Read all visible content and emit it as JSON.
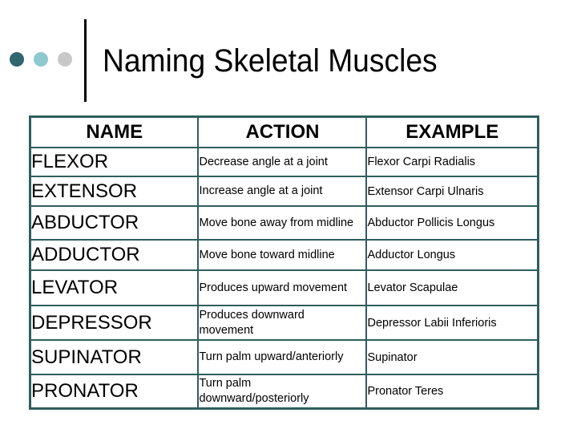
{
  "slide": {
    "title": "Naming Skeletal Muscles",
    "decor": {
      "dot_colors": [
        "#2f6670",
        "#8ec9cf",
        "#c8c8c8"
      ],
      "border_color": "#2f5e5e"
    }
  },
  "table": {
    "headers": [
      "NAME",
      "ACTION",
      "EXAMPLE"
    ],
    "rows": [
      {
        "name": "FLEXOR",
        "action": "Decrease angle at a joint",
        "example": "Flexor Carpi Radialis"
      },
      {
        "name": "EXTENSOR",
        "action": "Increase angle at a joint",
        "example": "Extensor Carpi Ulnaris"
      },
      {
        "name": "ABDUCTOR",
        "action": "Move bone away from midline",
        "example": "Abductor Pollicis Longus"
      },
      {
        "name": "ADDUCTOR",
        "action": "Move bone toward midline",
        "example": "Adductor Longus"
      },
      {
        "name": "LEVATOR",
        "action": "Produces upward movement",
        "example": "Levator Scapulae"
      },
      {
        "name": "DEPRESSOR",
        "action": "Produces downward movement",
        "example": "Depressor Labii Inferioris"
      },
      {
        "name": "SUPINATOR",
        "action": "Turn palm upward/anteriorly",
        "example": "Supinator"
      },
      {
        "name": "PRONATOR",
        "action": "Turn palm downward/posteriorly",
        "example": "Pronator Teres"
      }
    ]
  }
}
